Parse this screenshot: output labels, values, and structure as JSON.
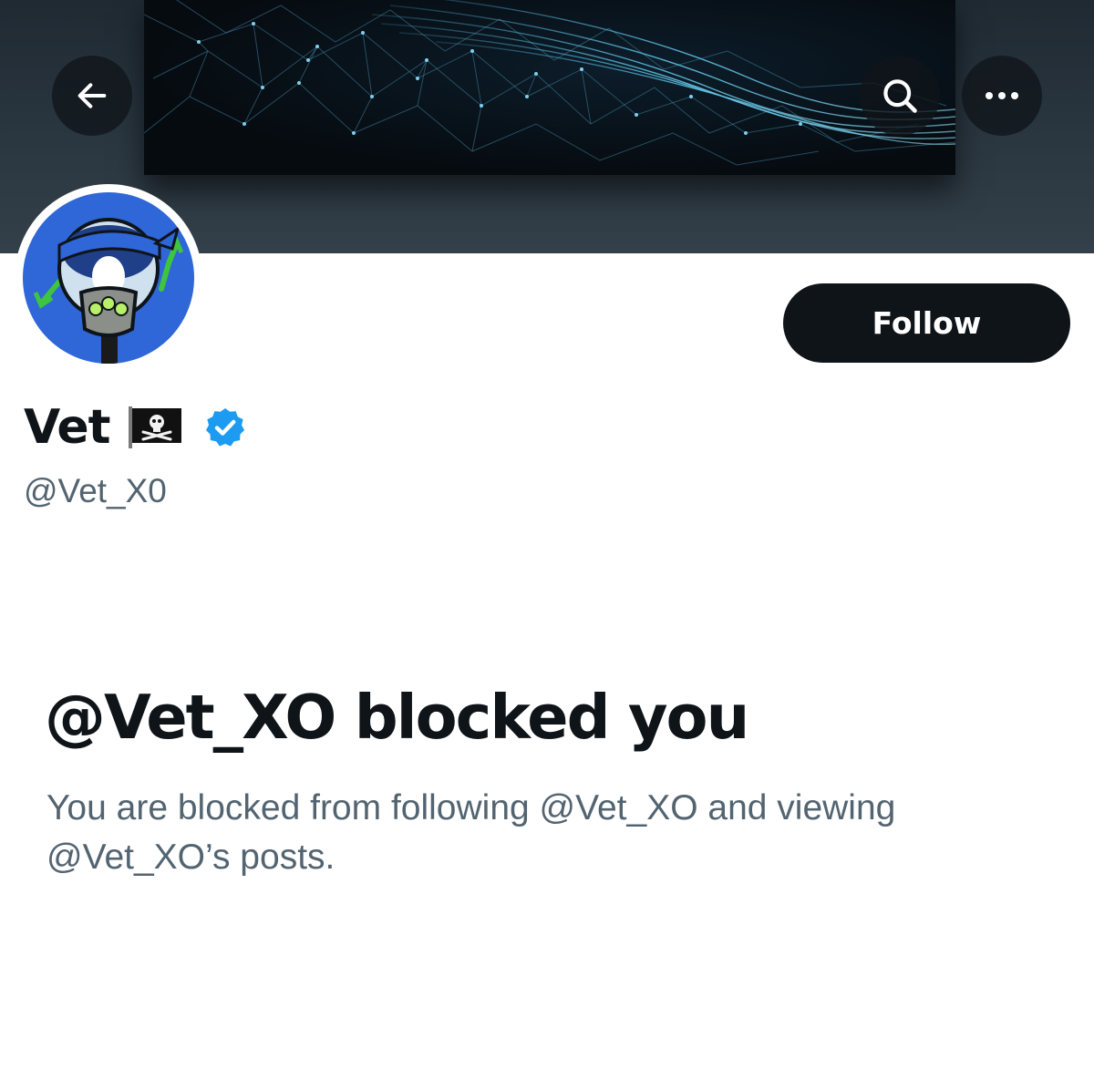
{
  "profile": {
    "display_name": "Vet",
    "handle": "@Vet_X0",
    "name_emoji": "pirate-flag-icon",
    "verified": true,
    "verified_color": "#1d9bf0"
  },
  "actions": {
    "follow_label": "Follow"
  },
  "blocked": {
    "title": "@Vet_XO blocked you",
    "description": "You are blocked from following @Vet_XO and viewing @Vet_XO’s posts."
  },
  "icons": {
    "back": "arrow-left-icon",
    "search": "search-icon",
    "more": "more-horizontal-icon"
  },
  "colors": {
    "text_primary": "#0f1419",
    "text_secondary": "#536471",
    "follow_bg": "#0f1419",
    "avatar_bg": "#2f66d8"
  }
}
